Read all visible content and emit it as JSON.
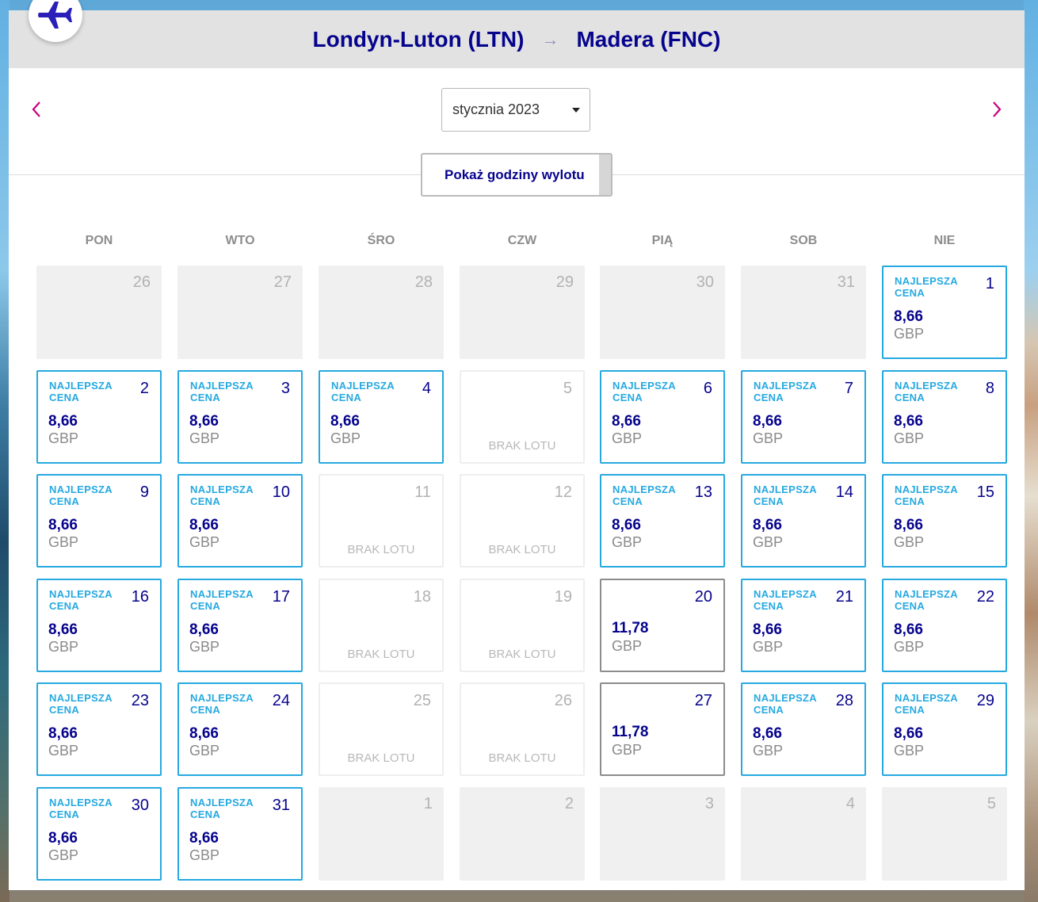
{
  "route": {
    "origin": "Londyn-Luton (LTN)",
    "arrow": "→",
    "destination": "Madera (FNC)"
  },
  "month_select": {
    "value": "stycznia 2023"
  },
  "show_times_button": "Pokaż godziny wylotu",
  "weekdays": [
    "PON",
    "WTO",
    "ŚRO",
    "CZW",
    "PIĄ",
    "SOB",
    "NIE"
  ],
  "labels": {
    "best_price": "NAJLEPSZA CENA",
    "no_flight": "BRAK LOTU"
  },
  "colors": {
    "brand_navy": "#06038d",
    "best_price_blue": "#26a9e0",
    "header_gray": "#e2e2e2",
    "nav_arrow_magenta": "#c6007e"
  },
  "icons": {
    "logo": "airplane-icon",
    "prev": "chevron-left-icon",
    "next": "chevron-right-icon",
    "dropdown": "caret-down-icon"
  },
  "calendar": [
    {
      "day": "26",
      "type": "outside"
    },
    {
      "day": "27",
      "type": "outside"
    },
    {
      "day": "28",
      "type": "outside"
    },
    {
      "day": "29",
      "type": "outside"
    },
    {
      "day": "30",
      "type": "outside"
    },
    {
      "day": "31",
      "type": "outside"
    },
    {
      "day": "1",
      "type": "best",
      "price": "8,66",
      "currency": "GBP"
    },
    {
      "day": "2",
      "type": "best",
      "price": "8,66",
      "currency": "GBP"
    },
    {
      "day": "3",
      "type": "best",
      "price": "8,66",
      "currency": "GBP"
    },
    {
      "day": "4",
      "type": "best",
      "price": "8,66",
      "currency": "GBP"
    },
    {
      "day": "5",
      "type": "noflight"
    },
    {
      "day": "6",
      "type": "best",
      "price": "8,66",
      "currency": "GBP"
    },
    {
      "day": "7",
      "type": "best",
      "price": "8,66",
      "currency": "GBP"
    },
    {
      "day": "8",
      "type": "best",
      "price": "8,66",
      "currency": "GBP"
    },
    {
      "day": "9",
      "type": "best",
      "price": "8,66",
      "currency": "GBP"
    },
    {
      "day": "10",
      "type": "best",
      "price": "8,66",
      "currency": "GBP"
    },
    {
      "day": "11",
      "type": "noflight"
    },
    {
      "day": "12",
      "type": "noflight"
    },
    {
      "day": "13",
      "type": "best",
      "price": "8,66",
      "currency": "GBP"
    },
    {
      "day": "14",
      "type": "best",
      "price": "8,66",
      "currency": "GBP"
    },
    {
      "day": "15",
      "type": "best",
      "price": "8,66",
      "currency": "GBP"
    },
    {
      "day": "16",
      "type": "best",
      "price": "8,66",
      "currency": "GBP"
    },
    {
      "day": "17",
      "type": "best",
      "price": "8,66",
      "currency": "GBP"
    },
    {
      "day": "18",
      "type": "noflight"
    },
    {
      "day": "19",
      "type": "noflight"
    },
    {
      "day": "20",
      "type": "regular",
      "price": "11,78",
      "currency": "GBP"
    },
    {
      "day": "21",
      "type": "best",
      "price": "8,66",
      "currency": "GBP"
    },
    {
      "day": "22",
      "type": "best",
      "price": "8,66",
      "currency": "GBP"
    },
    {
      "day": "23",
      "type": "best",
      "price": "8,66",
      "currency": "GBP"
    },
    {
      "day": "24",
      "type": "best",
      "price": "8,66",
      "currency": "GBP"
    },
    {
      "day": "25",
      "type": "noflight"
    },
    {
      "day": "26",
      "type": "noflight"
    },
    {
      "day": "27",
      "type": "regular",
      "price": "11,78",
      "currency": "GBP"
    },
    {
      "day": "28",
      "type": "best",
      "price": "8,66",
      "currency": "GBP"
    },
    {
      "day": "29",
      "type": "best",
      "price": "8,66",
      "currency": "GBP"
    },
    {
      "day": "30",
      "type": "best",
      "price": "8,66",
      "currency": "GBP"
    },
    {
      "day": "31",
      "type": "best",
      "price": "8,66",
      "currency": "GBP"
    },
    {
      "day": "1",
      "type": "outside"
    },
    {
      "day": "2",
      "type": "outside"
    },
    {
      "day": "3",
      "type": "outside"
    },
    {
      "day": "4",
      "type": "outside"
    },
    {
      "day": "5",
      "type": "outside"
    }
  ]
}
